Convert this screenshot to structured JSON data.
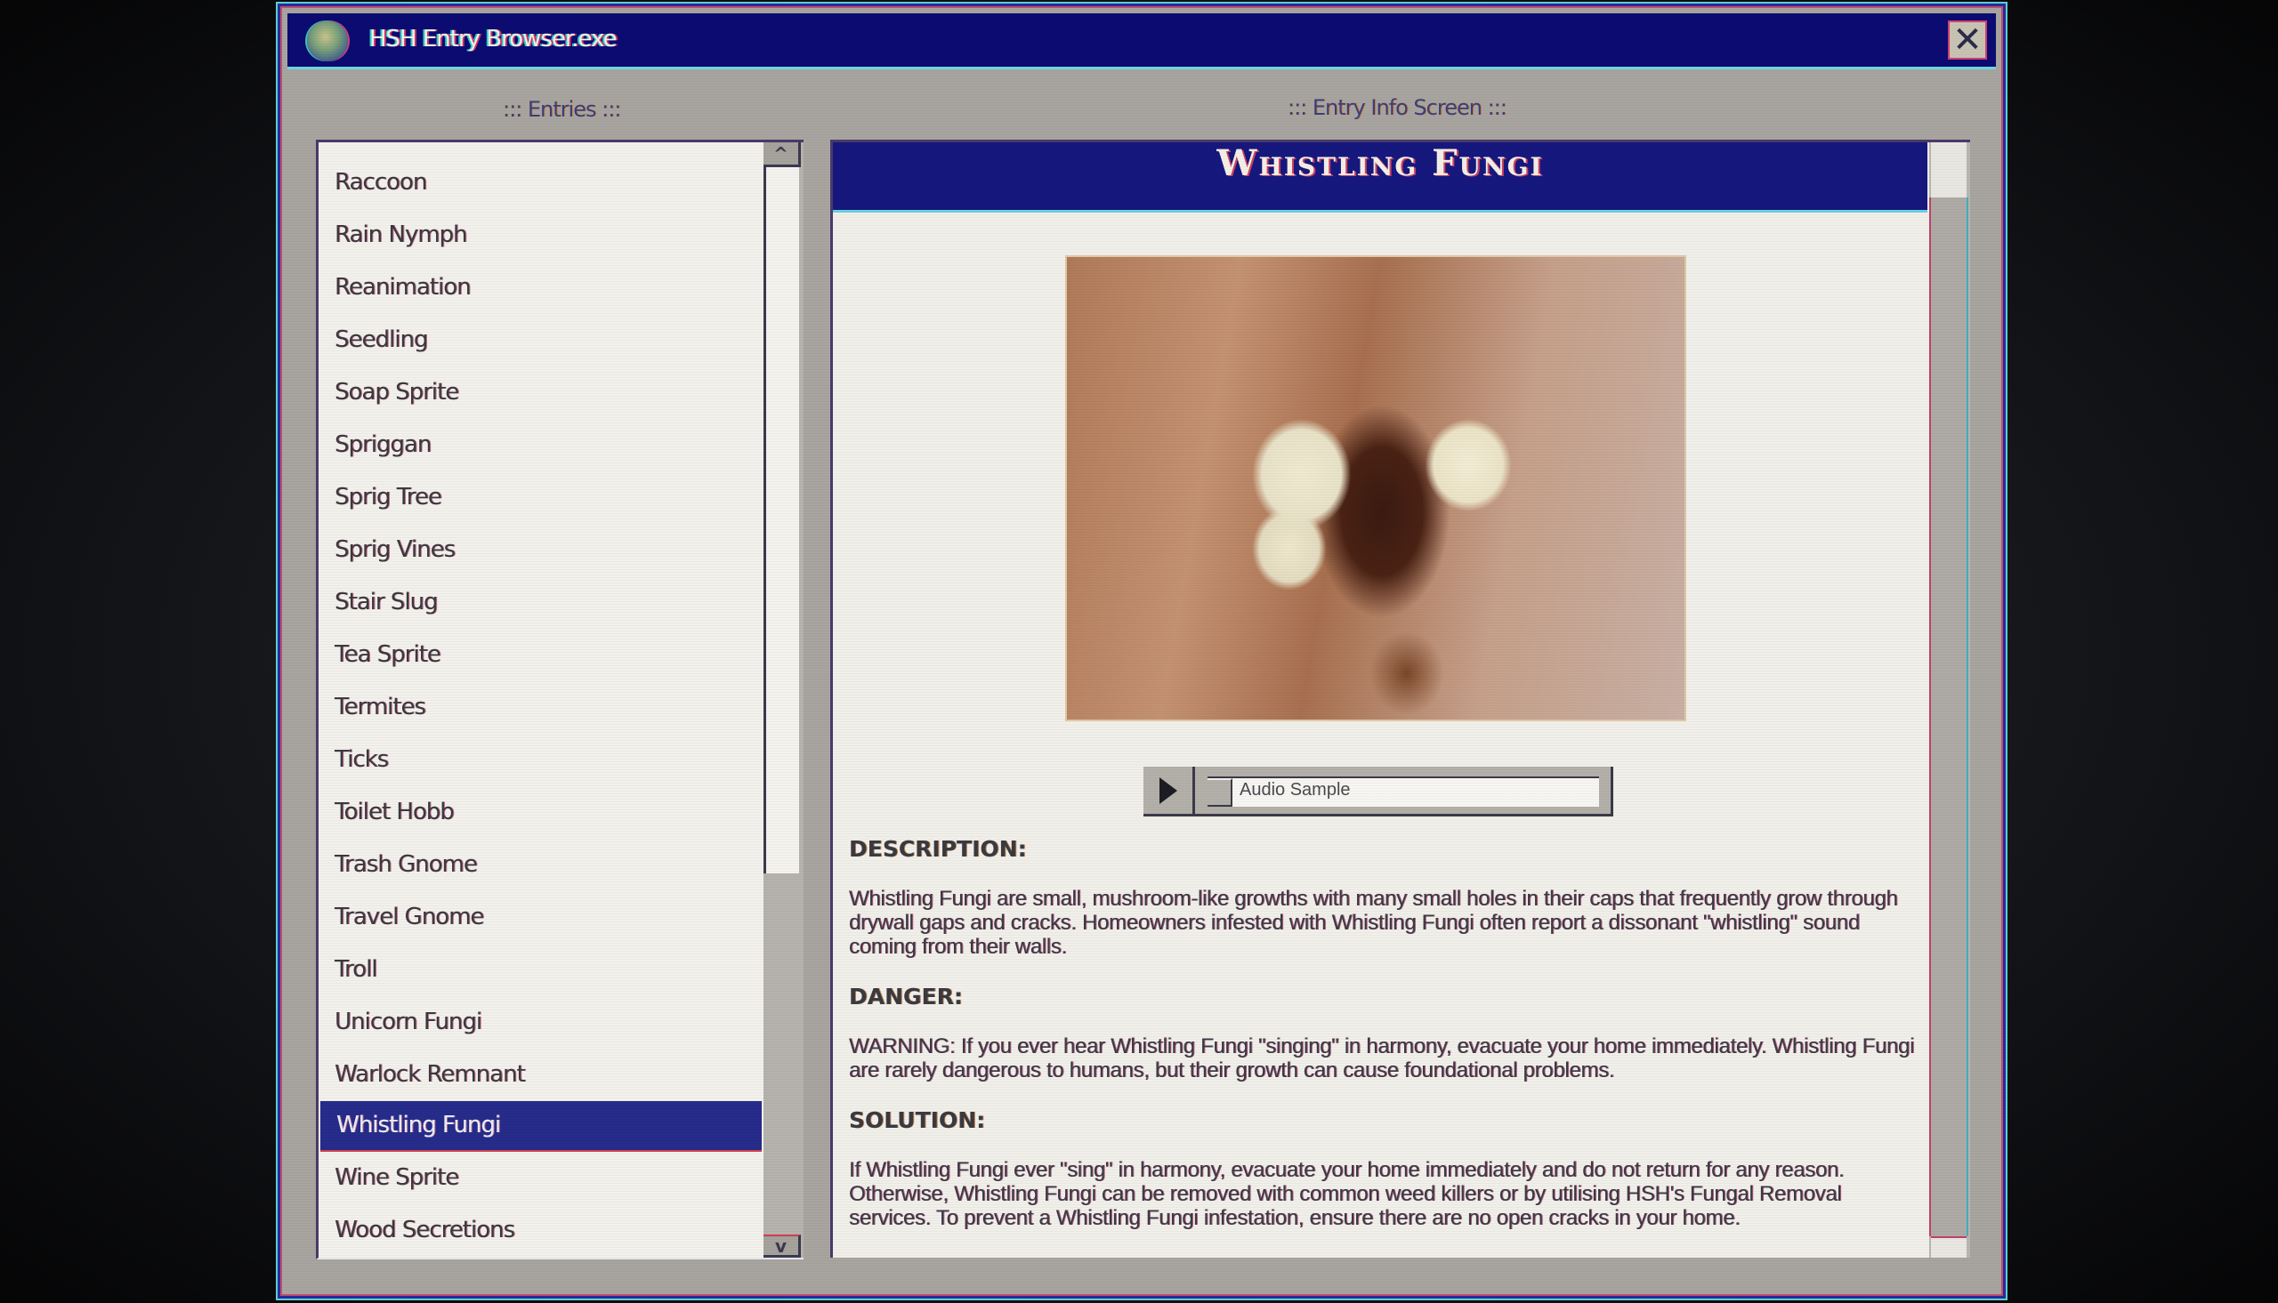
{
  "window": {
    "title": "HSH Entry Browser.exe",
    "app_icon": "globe-icon",
    "close_icon": "close-x-icon",
    "close_glyph": "✕"
  },
  "entries_panel": {
    "label": "::: Entries :::",
    "scroll_up_glyph": "^",
    "scroll_down_glyph": "v",
    "items": [
      {
        "label": "Raccoon"
      },
      {
        "label": "Rain Nymph"
      },
      {
        "label": "Reanimation"
      },
      {
        "label": "Seedling"
      },
      {
        "label": "Soap Sprite"
      },
      {
        "label": "Spriggan"
      },
      {
        "label": "Sprig Tree"
      },
      {
        "label": "Sprig Vines"
      },
      {
        "label": "Stair Slug"
      },
      {
        "label": "Tea Sprite"
      },
      {
        "label": "Termites"
      },
      {
        "label": "Ticks"
      },
      {
        "label": "Toilet Hobb"
      },
      {
        "label": "Trash Gnome"
      },
      {
        "label": "Travel Gnome"
      },
      {
        "label": "Troll"
      },
      {
        "label": "Unicorn Fungi"
      },
      {
        "label": "Warlock Remnant"
      },
      {
        "label": "Whistling Fungi",
        "selected": true
      },
      {
        "label": "Wine Sprite"
      },
      {
        "label": "Wood Secretions"
      }
    ],
    "selected": "Whistling Fungi"
  },
  "info_panel": {
    "label": "::: Entry Info Screen :::",
    "title": "Whistling Fungi",
    "image_alt": "Photo of pale mushroom-like growths with holes in their caps emerging from a crack in a drywall",
    "audio": {
      "play_icon": "play-icon",
      "label": "Audio Sample"
    },
    "sections": [
      {
        "heading": "DESCRIPTION:",
        "text": "Whistling Fungi are small, mushroom-like growths with many small holes in their caps that frequently grow through drywall gaps and cracks. Homeowners infested with Whistling Fungi often report a dissonant \"whistling\" sound coming from their walls."
      },
      {
        "heading": "DANGER:",
        "text": "WARNING: If you ever hear Whistling Fungi \"singing\" in harmony, evacuate your home immediately. Whistling Fungi are rarely dangerous to humans, but their growth can cause foundational problems."
      },
      {
        "heading": "SOLUTION:",
        "text": "If Whistling Fungi ever \"sing\" in harmony, evacuate your home immediately and do not return for any reason. Otherwise, Whistling Fungi can be removed with common weed killers or by utilising HSH's Fungal Removal services. To prevent a Whistling Fungi infestation, ensure there are no open cracks in your home."
      }
    ]
  },
  "colors": {
    "titlebar": "#0b0b72",
    "selection": "#262c8a",
    "panel_bg": "#a8a5a0",
    "content_bg": "#f1efea"
  }
}
